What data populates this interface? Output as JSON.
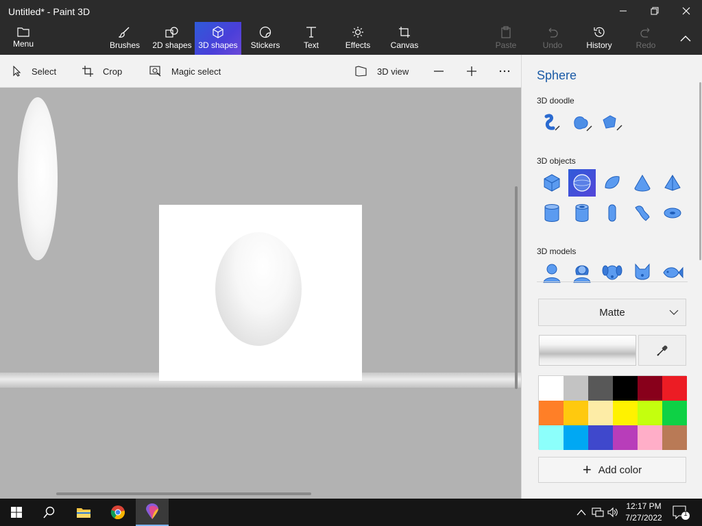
{
  "window": {
    "title": "Untitled* - Paint 3D"
  },
  "ribbon": {
    "menu_label": "Menu",
    "tabs": [
      {
        "label": "Brushes",
        "icon": "brush-icon"
      },
      {
        "label": "2D shapes",
        "icon": "2d-shapes-icon"
      },
      {
        "label": "3D shapes",
        "icon": "3d-shapes-icon",
        "active": true
      },
      {
        "label": "Stickers",
        "icon": "stickers-icon"
      },
      {
        "label": "Text",
        "icon": "text-icon"
      },
      {
        "label": "Effects",
        "icon": "effects-icon"
      },
      {
        "label": "Canvas",
        "icon": "canvas-icon"
      }
    ],
    "actions": [
      {
        "label": "Paste",
        "icon": "paste-icon",
        "enabled": false
      },
      {
        "label": "Undo",
        "icon": "undo-icon",
        "enabled": false
      },
      {
        "label": "History",
        "icon": "history-icon",
        "enabled": true
      },
      {
        "label": "Redo",
        "icon": "redo-icon",
        "enabled": false
      }
    ],
    "active_color": "#3b57d9"
  },
  "toolbar": {
    "select": "Select",
    "crop": "Crop",
    "magic_select": "Magic select",
    "view_3d": "3D view",
    "zoom_out_icon": "minus-icon",
    "zoom_in_icon": "plus-icon",
    "more_icon": "more-icon"
  },
  "panel": {
    "title": "Sphere",
    "doodle_label": "3D doodle",
    "objects_label": "3D objects",
    "models_label": "3D models",
    "doodles": [
      "sharp-edge-doodle-icon",
      "soft-edge-doodle-icon",
      "tube-doodle-icon"
    ],
    "objects": [
      "cube-icon",
      "sphere-icon",
      "hemisphere-icon",
      "cone-icon",
      "pyramid-icon",
      "cylinder-icon",
      "tube-icon",
      "capsule-icon",
      "curved-cylinder-icon",
      "donut-icon"
    ],
    "selected_object": "sphere-icon",
    "models": [
      "man-icon",
      "woman-icon",
      "dog-icon",
      "cat-icon",
      "fish-icon"
    ],
    "finish": "Matte",
    "add_color": "Add color",
    "palette": [
      "#ffffff",
      "#c3c3c3",
      "#585858",
      "#000000",
      "#88001b",
      "#ec1c24",
      "#ff7f27",
      "#ffc90e",
      "#fdeca6",
      "#fff200",
      "#c4ff0e",
      "#0ed145",
      "#8cfffb",
      "#00a8f3",
      "#3f48cc",
      "#b83dba",
      "#ffaec8",
      "#b97a56"
    ]
  },
  "taskbar": {
    "apps": [
      "windows-start-icon",
      "search-icon",
      "file-explorer-icon",
      "chrome-icon",
      "paint-3d-icon"
    ],
    "time": "12:17 PM",
    "date": "7/27/2022",
    "notification_count": "1"
  }
}
